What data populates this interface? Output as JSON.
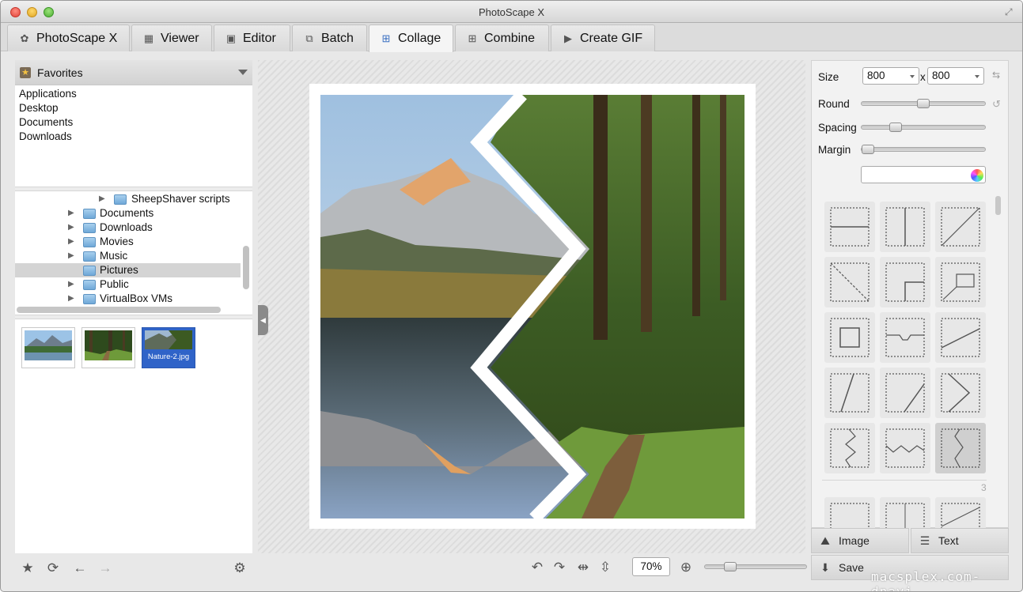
{
  "window": {
    "title": "PhotoScape X"
  },
  "tabs": [
    {
      "label": "PhotoScape X",
      "icon": "photoscape-icon"
    },
    {
      "label": "Viewer",
      "icon": "grid-icon"
    },
    {
      "label": "Editor",
      "icon": "image-edit-icon"
    },
    {
      "label": "Batch",
      "icon": "batch-icon"
    },
    {
      "label": "Collage",
      "icon": "collage-icon",
      "active": true
    },
    {
      "label": "Combine",
      "icon": "combine-icon"
    },
    {
      "label": "Create GIF",
      "icon": "play-icon"
    }
  ],
  "sidebar": {
    "favorites_label": "Favorites",
    "favorites": [
      "Applications",
      "Desktop",
      "Documents",
      "Downloads"
    ],
    "tree": [
      {
        "label": "SheepShaver scripts"
      },
      {
        "label": "Documents"
      },
      {
        "label": "Downloads"
      },
      {
        "label": "Movies"
      },
      {
        "label": "Music"
      },
      {
        "label": "Pictures",
        "selected": true
      },
      {
        "label": "Public"
      },
      {
        "label": "VirtualBox VMs"
      }
    ],
    "thumbnails": [
      {
        "caption": ""
      },
      {
        "caption": ""
      },
      {
        "caption": "Nature-2.jpg",
        "selected": true
      }
    ]
  },
  "settings": {
    "size_label": "Size",
    "width": "800",
    "height": "800",
    "times": "x",
    "round_label": "Round",
    "spacing_label": "Spacing",
    "margin_label": "Margin",
    "round_value": 0.5,
    "spacing_value": 0.25,
    "margin_value": 0.0,
    "layout_page": "3"
  },
  "buttons": {
    "image": "Image",
    "text": "Text",
    "save": "Save"
  },
  "toolbar": {
    "zoom": "70%"
  },
  "watermark": "macsplex.com-dnavi"
}
